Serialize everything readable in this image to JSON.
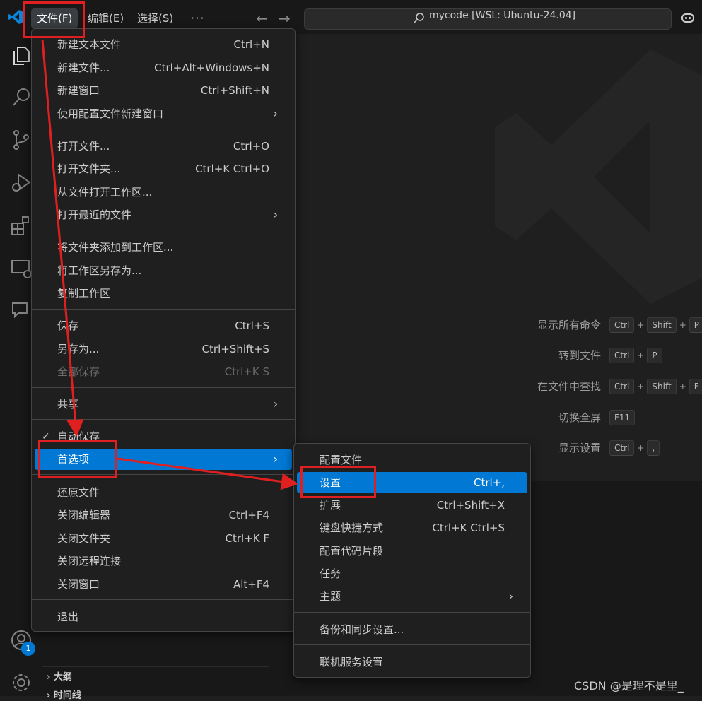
{
  "titlebar": {
    "menus": {
      "file": "文件(F)",
      "edit": "编辑(E)",
      "select": "选择(S)",
      "more": "···"
    },
    "nav_back": "←",
    "nav_forward": "→",
    "search_text": "mycode [WSL: Ubuntu-24.04]"
  },
  "activity": {
    "accounts_badge": "1"
  },
  "sidebar": {
    "outline": "大纲",
    "timeline": "时间线"
  },
  "editor": {
    "shortcuts": [
      {
        "label": "显示所有命令",
        "keys": [
          "Ctrl",
          "Shift",
          "P"
        ]
      },
      {
        "label": "转到文件",
        "keys": [
          "Ctrl",
          "P"
        ]
      },
      {
        "label": "在文件中查找",
        "keys": [
          "Ctrl",
          "Shift",
          "F"
        ]
      },
      {
        "label": "切换全屏",
        "keys": [
          "F11"
        ]
      },
      {
        "label": "显示设置",
        "keys": [
          "Ctrl",
          ","
        ]
      }
    ],
    "plus": "+"
  },
  "file_menu": {
    "items": [
      {
        "label": "新建文本文件",
        "shortcut": "Ctrl+N"
      },
      {
        "label": "新建文件...",
        "shortcut": "Ctrl+Alt+Windows+N"
      },
      {
        "label": "新建窗口",
        "shortcut": "Ctrl+Shift+N"
      },
      {
        "label": "使用配置文件新建窗口",
        "submenu": "›"
      },
      {
        "label": "打开文件...",
        "shortcut": "Ctrl+O"
      },
      {
        "label": "打开文件夹...",
        "shortcut": "Ctrl+K Ctrl+O"
      },
      {
        "label": "从文件打开工作区..."
      },
      {
        "label": "打开最近的文件",
        "submenu": "›"
      },
      {
        "label": "将文件夹添加到工作区..."
      },
      {
        "label": "将工作区另存为..."
      },
      {
        "label": "复制工作区"
      },
      {
        "label": "保存",
        "shortcut": "Ctrl+S"
      },
      {
        "label": "另存为...",
        "shortcut": "Ctrl+Shift+S"
      },
      {
        "label": "全部保存",
        "shortcut": "Ctrl+K S",
        "disabled": true
      },
      {
        "label": "共享",
        "submenu": "›"
      },
      {
        "label": "自动保存",
        "checked": "✓"
      },
      {
        "label": "首选项",
        "submenu": "›",
        "active": true
      },
      {
        "label": "还原文件"
      },
      {
        "label": "关闭编辑器",
        "shortcut": "Ctrl+F4"
      },
      {
        "label": "关闭文件夹",
        "shortcut": "Ctrl+K F"
      },
      {
        "label": "关闭远程连接"
      },
      {
        "label": "关闭窗口",
        "shortcut": "Alt+F4"
      },
      {
        "label": "退出"
      }
    ]
  },
  "pref_menu": {
    "items": [
      {
        "label": "配置文件"
      },
      {
        "label": "设置",
        "shortcut": "Ctrl+,",
        "active": true
      },
      {
        "label": "扩展",
        "shortcut": "Ctrl+Shift+X"
      },
      {
        "label": "键盘快捷方式",
        "shortcut": "Ctrl+K Ctrl+S"
      },
      {
        "label": "配置代码片段"
      },
      {
        "label": "任务"
      },
      {
        "label": "主题",
        "submenu": "›"
      },
      {
        "label": "备份和同步设置..."
      },
      {
        "label": "联机服务设置"
      }
    ]
  },
  "watermark": "CSDN @是理不是里_",
  "colors": {
    "accent": "#0078d4",
    "annotation": "#e02020",
    "background": "#1f1f1f"
  },
  "icons": [
    "vscode-logo-icon",
    "search-icon",
    "copilot-icon",
    "explorer-icon",
    "search-view-icon",
    "source-control-icon",
    "run-debug-icon",
    "extensions-icon",
    "remote-explorer-icon",
    "chat-icon",
    "accounts-icon",
    "settings-gear-icon"
  ]
}
